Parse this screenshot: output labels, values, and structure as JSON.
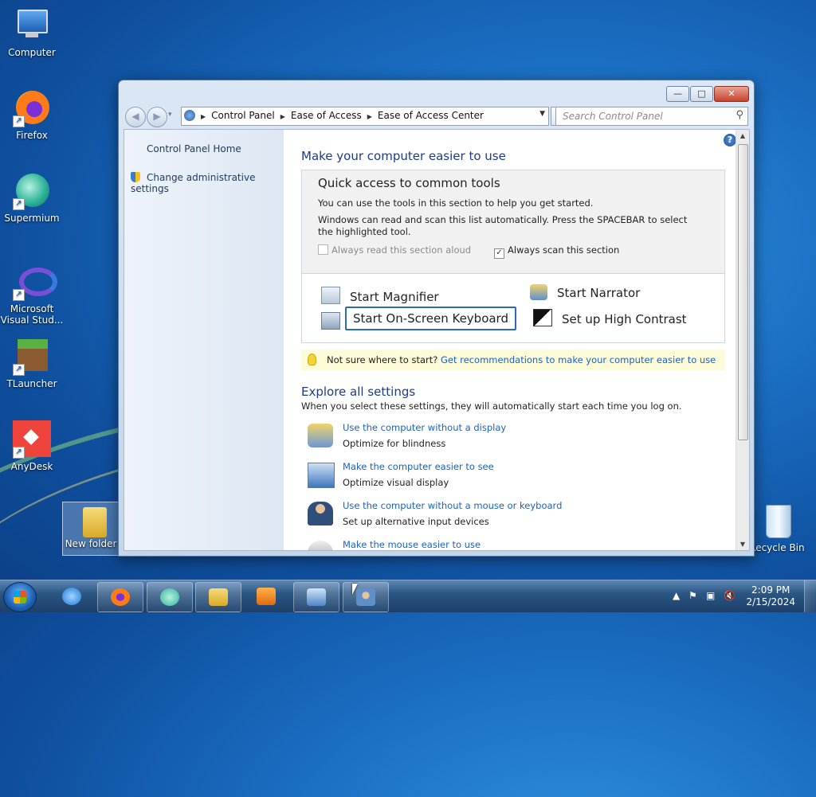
{
  "desktop": {
    "icons": [
      {
        "label": "Computer"
      },
      {
        "label": "Firefox"
      },
      {
        "label": "Supermium"
      },
      {
        "label": "Microsoft Visual Stud..."
      },
      {
        "label": "TLauncher"
      },
      {
        "label": "AnyDesk"
      },
      {
        "label": "New folder"
      },
      {
        "label": "Recycle Bin"
      }
    ]
  },
  "window": {
    "buttons": {
      "minimize": "—",
      "maximize": "□",
      "close": "✕"
    },
    "nav": {
      "back": "◀",
      "forward": "▶",
      "recent": "▾"
    },
    "breadcrumbs": [
      "Control Panel",
      "Ease of Access",
      "Ease of Access Center"
    ],
    "search_placeholder": "Search Control Panel",
    "sidebar": {
      "home": "Control Panel Home",
      "admin": "Change administrative settings"
    },
    "main": {
      "heading": "Make your computer easier to use",
      "quick_access": {
        "title": "Quick access to common tools",
        "line1": "You can use the tools in this section to help you get started.",
        "line2": "Windows can read and scan this list automatically.  Press the SPACEBAR to select the highlighted tool.",
        "checkbox_read": {
          "label": "Always read this section aloud",
          "checked": false
        },
        "checkbox_scan": {
          "label": "Always scan this section",
          "checked": true
        },
        "tools": {
          "magnifier": "Start Magnifier",
          "narrator": "Start Narrator",
          "keyboard": "Start On-Screen Keyboard",
          "contrast": "Set up High Contrast"
        }
      },
      "tip": {
        "question": "Not sure where to start?",
        "link": "Get recommendations to make your computer easier to use"
      },
      "explore": {
        "heading": "Explore all settings",
        "subtitle": "When you select these settings, they will automatically start each time you log on.",
        "settings": [
          {
            "link": "Use the computer without a display",
            "desc": "Optimize for blindness"
          },
          {
            "link": "Make the computer easier to see",
            "desc": "Optimize visual display"
          },
          {
            "link": "Use the computer without a mouse or keyboard",
            "desc": "Set up alternative input devices"
          },
          {
            "link": "Make the mouse easier to use",
            "desc": ""
          }
        ]
      }
    }
  },
  "taskbar": {
    "time": "2:09 PM",
    "date": "2/15/2024"
  }
}
